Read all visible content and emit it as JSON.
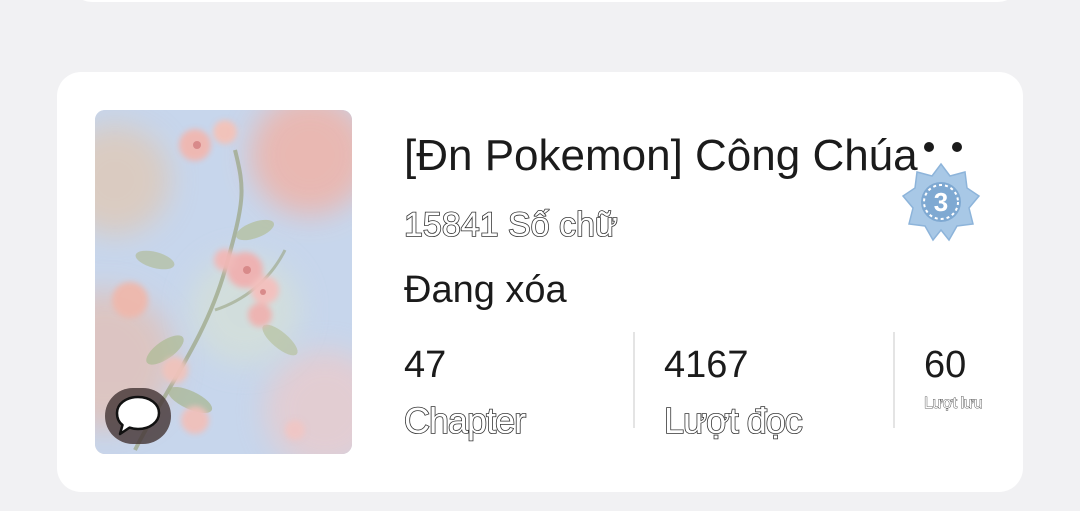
{
  "story": {
    "title": "[Đn Pokemon] Công Chúa",
    "word_count": "15841 Số chữ",
    "status": "Đang xóa",
    "rank_badge": "3",
    "stats": [
      {
        "value": "47",
        "label": "Chapter"
      },
      {
        "value": "4167",
        "label": "Lượt đọc"
      },
      {
        "value": "60",
        "label": "Lượt lưu"
      }
    ]
  },
  "icons": {
    "comment": "comment-bubble-icon",
    "more": "more-dots-icon",
    "badge": "rank-badge-icon"
  },
  "colors": {
    "background": "#f1f1f3",
    "card": "#ffffff",
    "text": "#1b1b1b",
    "badge": "#a9c9e4"
  }
}
